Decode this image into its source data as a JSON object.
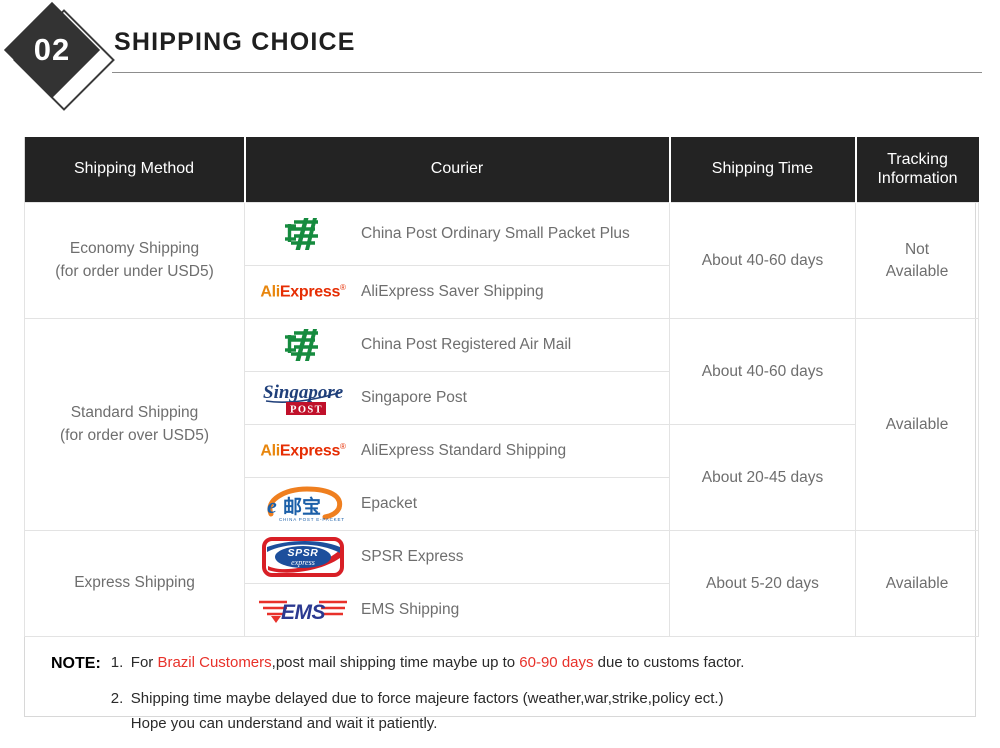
{
  "header": {
    "number": "02",
    "title": "SHIPPING CHOICE"
  },
  "table": {
    "columns": [
      {
        "label": "Shipping Method",
        "name": "shipping-method"
      },
      {
        "label": "Courier",
        "name": "courier"
      },
      {
        "label": "Shipping Time",
        "name": "shipping-time"
      },
      {
        "label": "Tracking Information",
        "name": "tracking-information"
      }
    ],
    "column_header_tracking_line1": "Tracking",
    "column_header_tracking_line2": "Information",
    "groups": [
      {
        "method_line1": "Economy Shipping",
        "method_line2": "(for order under USD5)",
        "couriers": [
          {
            "logo": "china-post-logo",
            "name": "China Post Ordinary Small Packet Plus"
          },
          {
            "logo": "aliexpress-logo",
            "name": "AliExpress Saver Shipping"
          }
        ],
        "times": [
          {
            "label": "About 40-60 days",
            "rows": 2
          }
        ],
        "tracking": "Not Available",
        "tracking_line1": "Not",
        "tracking_line2": "Available"
      },
      {
        "method_line1": "Standard Shipping",
        "method_line2": "(for order over USD5)",
        "couriers": [
          {
            "logo": "china-post-logo",
            "name": "China Post Registered Air Mail"
          },
          {
            "logo": "singapore-post-logo",
            "name": "Singapore Post"
          },
          {
            "logo": "aliexpress-logo",
            "name": "AliExpress Standard Shipping"
          },
          {
            "logo": "epacket-logo",
            "name": "Epacket"
          }
        ],
        "times": [
          {
            "label": "About 40-60 days",
            "rows": 2
          },
          {
            "label": "About 20-45 days",
            "rows": 2
          }
        ],
        "tracking": "Available"
      },
      {
        "method_line1": "Express Shipping",
        "method_line2": "",
        "couriers": [
          {
            "logo": "spsr-express-logo",
            "name": "SPSR Express"
          },
          {
            "logo": "ems-logo",
            "name": "EMS Shipping"
          }
        ],
        "times": [
          {
            "label": "About 5-20 days",
            "rows": 2
          }
        ],
        "tracking": "Available"
      }
    ]
  },
  "note": {
    "label": "NOTE:",
    "items": [
      {
        "num": "1.",
        "seg1": "For ",
        "hl1": "Brazil Customers",
        "seg2": ",post mail shipping time maybe up to ",
        "hl2": "60-90 days",
        "seg3": " due to customs factor."
      },
      {
        "num": "2.",
        "line1": "Shipping time maybe delayed due to force majeure factors (weather,war,strike,policy ect.)",
        "line2": "Hope you can understand and wait it patiently."
      }
    ]
  },
  "colors": {
    "header_bar": "#232323",
    "accent_red": "#e8312a",
    "aliexpress_orange": "#e8860d",
    "aliexpress_red": "#e62e04",
    "china_post_green": "#168b3f",
    "singapore_navy": "#1f3f7a",
    "singapore_red": "#c0102a",
    "ems_blue": "#2b3990",
    "ems_red": "#e8312a",
    "epacket_blue": "#1b5fa8",
    "epacket_orange": "#ef7f1f",
    "spsr_red": "#d81f26",
    "spsr_blue": "#1d4f9c"
  }
}
